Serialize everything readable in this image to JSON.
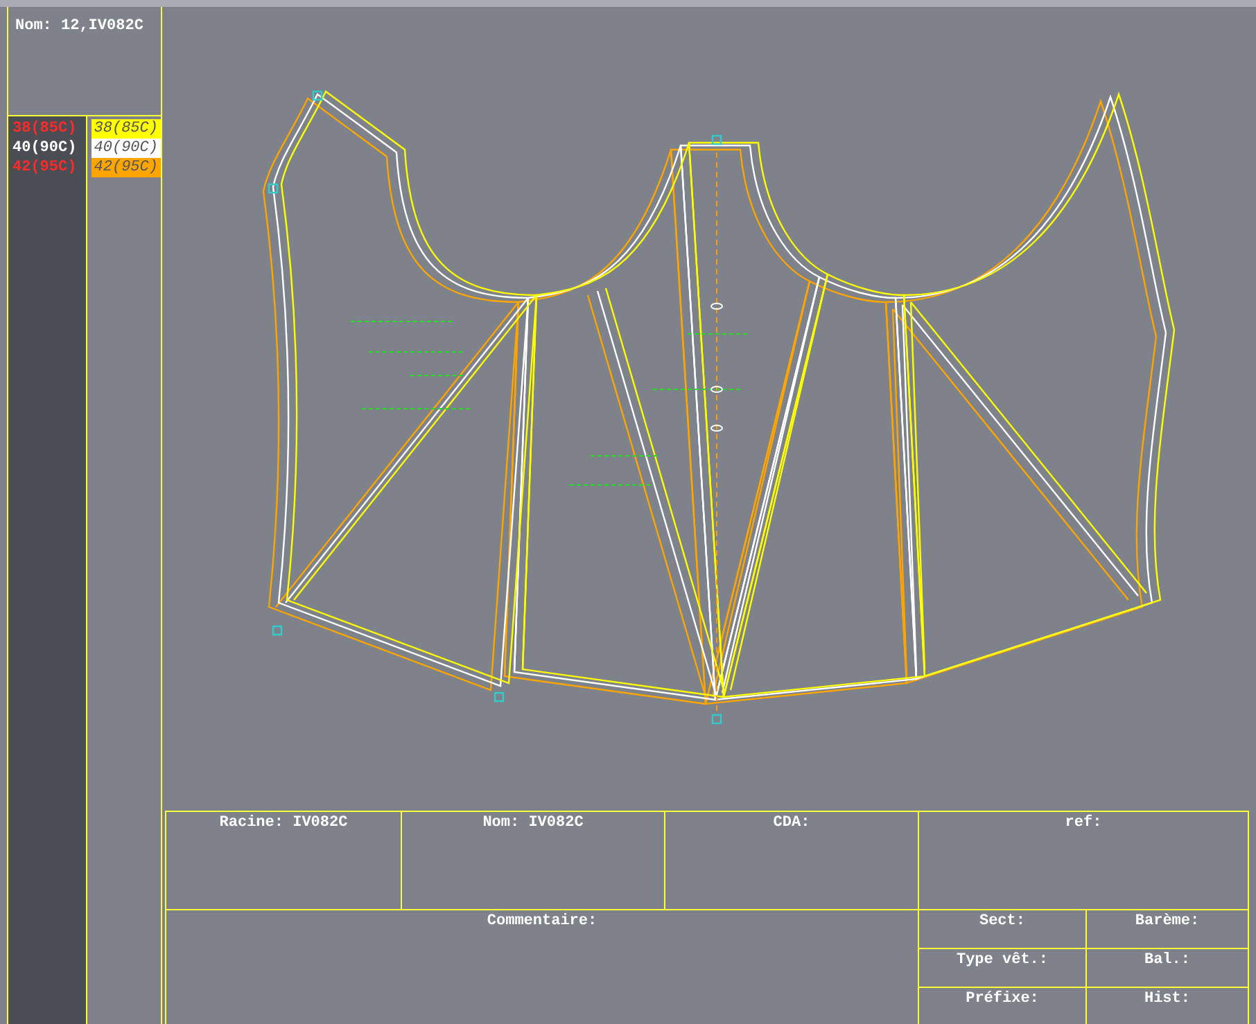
{
  "header": {
    "name": "Nom: 12,IV082C"
  },
  "size_legend": {
    "text_column": [
      {
        "label": "38(85C)",
        "color": "#ff2a2a"
      },
      {
        "label": "40(90C)",
        "color": "#ffffff"
      },
      {
        "label": "42(95C)",
        "color": "#ff2a2a"
      }
    ],
    "swatch_column": [
      {
        "label": "38(85C)",
        "color": "#ffff00"
      },
      {
        "label": "40(90C)",
        "color": "#ffffff"
      },
      {
        "label": "42(95C)",
        "color": "#ffa500"
      }
    ]
  },
  "title_block": {
    "top": [
      "Racine: IV082C",
      "Nom: IV082C",
      "CDA:",
      "ref:"
    ],
    "comment": "Commentaire:",
    "side": [
      "Sect:",
      "Barème:",
      "Type vêt.:",
      "Bal.:",
      "Préfixe:",
      "Hist:"
    ]
  }
}
